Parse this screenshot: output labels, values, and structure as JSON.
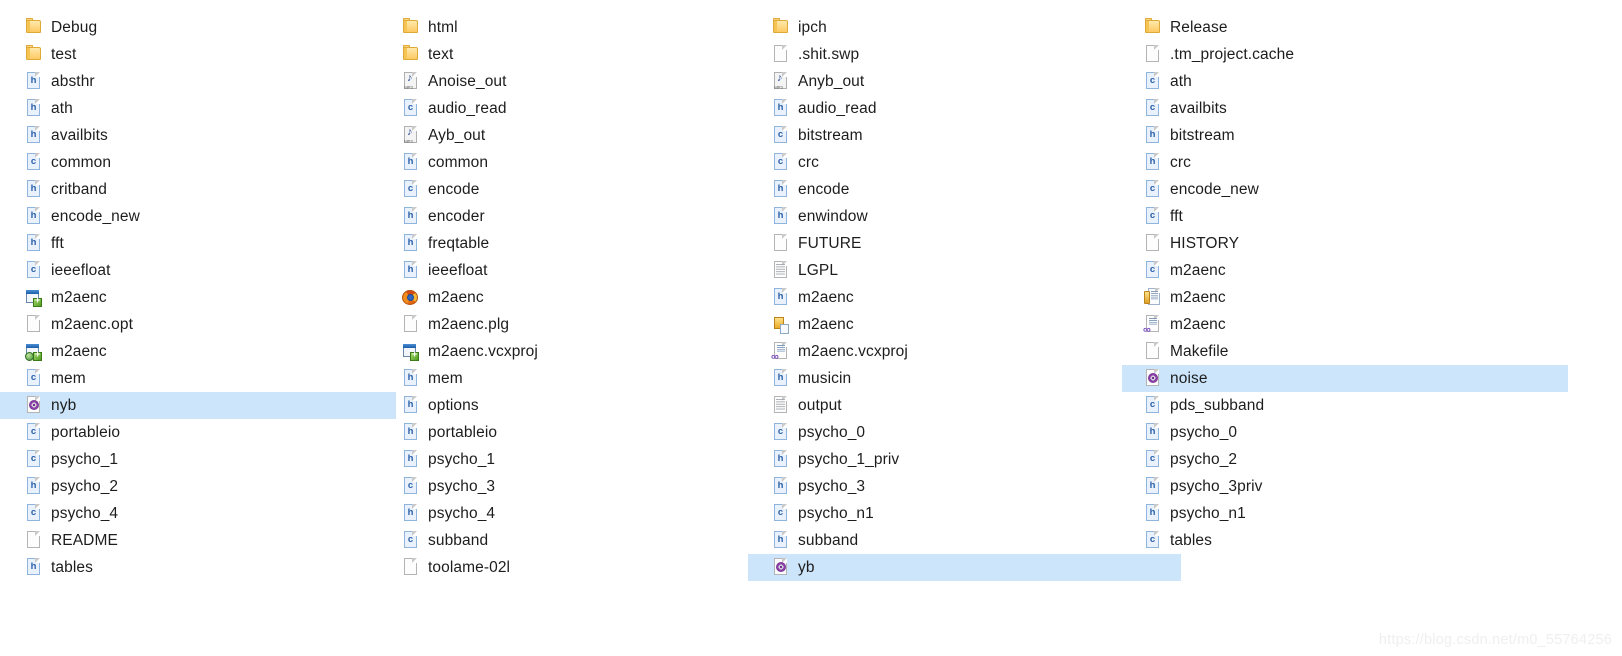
{
  "view": {
    "type": "file-explorer-listing",
    "selection_color": "#cce5fb",
    "background_color": "#ffffff",
    "watermark": "https://blog.csdn.net/m0_55764256"
  },
  "columns": [
    {
      "name": "column-1",
      "items": [
        {
          "label": "Debug",
          "icon": "folder-icon",
          "type": "folder",
          "selected": false
        },
        {
          "label": "test",
          "icon": "folder-icon",
          "type": "folder",
          "selected": false
        },
        {
          "label": "absthr",
          "icon": "h-header-file-icon",
          "type": "h",
          "selected": false
        },
        {
          "label": "ath",
          "icon": "h-header-file-icon",
          "type": "h",
          "selected": false
        },
        {
          "label": "availbits",
          "icon": "h-header-file-icon",
          "type": "h",
          "selected": false
        },
        {
          "label": "common",
          "icon": "c-source-file-icon",
          "type": "c",
          "selected": false
        },
        {
          "label": "critband",
          "icon": "h-header-file-icon",
          "type": "h",
          "selected": false
        },
        {
          "label": "encode_new",
          "icon": "h-header-file-icon",
          "type": "h",
          "selected": false
        },
        {
          "label": "fft",
          "icon": "h-header-file-icon",
          "type": "h",
          "selected": false
        },
        {
          "label": "ieeefloat",
          "icon": "c-source-file-icon",
          "type": "c",
          "selected": false
        },
        {
          "label": "m2aenc",
          "icon": "vs-project-icon",
          "type": "vsproj",
          "selected": false
        },
        {
          "label": "m2aenc.opt",
          "icon": "blank-document-icon",
          "type": "doc",
          "selected": false
        },
        {
          "label": "m2aenc",
          "icon": "vs-web-project-icon",
          "type": "vsweb",
          "selected": false
        },
        {
          "label": "mem",
          "icon": "c-source-file-icon",
          "type": "c",
          "selected": false
        },
        {
          "label": "nyb",
          "icon": "object-file-icon",
          "type": "obj",
          "selected": true
        },
        {
          "label": "portableio",
          "icon": "c-source-file-icon",
          "type": "c",
          "selected": false
        },
        {
          "label": "psycho_1",
          "icon": "c-source-file-icon",
          "type": "c",
          "selected": false
        },
        {
          "label": "psycho_2",
          "icon": "h-header-file-icon",
          "type": "h",
          "selected": false
        },
        {
          "label": "psycho_4",
          "icon": "c-source-file-icon",
          "type": "c",
          "selected": false
        },
        {
          "label": "README",
          "icon": "blank-document-icon",
          "type": "doc",
          "selected": false
        },
        {
          "label": "tables",
          "icon": "h-header-file-icon",
          "type": "h",
          "selected": false
        }
      ]
    },
    {
      "name": "column-2",
      "items": [
        {
          "label": "html",
          "icon": "folder-icon",
          "type": "folder",
          "selected": false
        },
        {
          "label": "text",
          "icon": "folder-icon",
          "type": "folder",
          "selected": false
        },
        {
          "label": "Anoise_out",
          "icon": "mp3-audio-icon",
          "type": "mp3",
          "selected": false
        },
        {
          "label": "audio_read",
          "icon": "c-source-file-icon",
          "type": "c",
          "selected": false
        },
        {
          "label": "Ayb_out",
          "icon": "mp3-audio-icon",
          "type": "mp3",
          "selected": false
        },
        {
          "label": "common",
          "icon": "h-header-file-icon",
          "type": "h",
          "selected": false
        },
        {
          "label": "encode",
          "icon": "c-source-file-icon",
          "type": "c",
          "selected": false
        },
        {
          "label": "encoder",
          "icon": "h-header-file-icon",
          "type": "h",
          "selected": false
        },
        {
          "label": "freqtable",
          "icon": "h-header-file-icon",
          "type": "h",
          "selected": false
        },
        {
          "label": "ieeefloat",
          "icon": "h-header-file-icon",
          "type": "h",
          "selected": false
        },
        {
          "label": "m2aenc",
          "icon": "firefox-app-icon",
          "type": "exe",
          "selected": false
        },
        {
          "label": "m2aenc.plg",
          "icon": "blank-document-icon",
          "type": "doc",
          "selected": false
        },
        {
          "label": "m2aenc.vcxproj",
          "icon": "vs-project-icon",
          "type": "vsproj",
          "selected": false
        },
        {
          "label": "mem",
          "icon": "h-header-file-icon",
          "type": "h",
          "selected": false
        },
        {
          "label": "options",
          "icon": "h-header-file-icon",
          "type": "h",
          "selected": false
        },
        {
          "label": "portableio",
          "icon": "h-header-file-icon",
          "type": "h",
          "selected": false
        },
        {
          "label": "psycho_1",
          "icon": "h-header-file-icon",
          "type": "h",
          "selected": false
        },
        {
          "label": "psycho_3",
          "icon": "c-source-file-icon",
          "type": "c",
          "selected": false
        },
        {
          "label": "psycho_4",
          "icon": "h-header-file-icon",
          "type": "h",
          "selected": false
        },
        {
          "label": "subband",
          "icon": "c-source-file-icon",
          "type": "c",
          "selected": false
        },
        {
          "label": "toolame-02l",
          "icon": "blank-document-icon",
          "type": "doc",
          "selected": false
        }
      ]
    },
    {
      "name": "column-3",
      "items": [
        {
          "label": "ipch",
          "icon": "folder-icon",
          "type": "folder",
          "selected": false
        },
        {
          "label": ".shit.swp",
          "icon": "blank-document-icon",
          "type": "doc",
          "selected": false
        },
        {
          "label": "Anyb_out",
          "icon": "mp3-audio-icon",
          "type": "mp3",
          "selected": false
        },
        {
          "label": "audio_read",
          "icon": "h-header-file-icon",
          "type": "h",
          "selected": false
        },
        {
          "label": "bitstream",
          "icon": "c-source-file-icon",
          "type": "c",
          "selected": false
        },
        {
          "label": "crc",
          "icon": "c-source-file-icon",
          "type": "c",
          "selected": false
        },
        {
          "label": "encode",
          "icon": "h-header-file-icon",
          "type": "h",
          "selected": false
        },
        {
          "label": "enwindow",
          "icon": "h-header-file-icon",
          "type": "h",
          "selected": false
        },
        {
          "label": "FUTURE",
          "icon": "blank-document-icon",
          "type": "doc",
          "selected": false
        },
        {
          "label": "LGPL",
          "icon": "text-document-icon",
          "type": "txt",
          "selected": false
        },
        {
          "label": "m2aenc",
          "icon": "h-header-file-icon",
          "type": "h",
          "selected": false
        },
        {
          "label": "m2aenc",
          "icon": "package-app-icon",
          "type": "exe",
          "selected": false
        },
        {
          "label": "m2aenc.vcxproj",
          "icon": "vcxproj-icon",
          "type": "vcxproj",
          "selected": false
        },
        {
          "label": "musicin",
          "icon": "h-header-file-icon",
          "type": "h",
          "selected": false
        },
        {
          "label": "output",
          "icon": "text-document-icon",
          "type": "txt",
          "selected": false
        },
        {
          "label": "psycho_0",
          "icon": "c-source-file-icon",
          "type": "c",
          "selected": false
        },
        {
          "label": "psycho_1_priv",
          "icon": "h-header-file-icon",
          "type": "h",
          "selected": false
        },
        {
          "label": "psycho_3",
          "icon": "h-header-file-icon",
          "type": "h",
          "selected": false
        },
        {
          "label": "psycho_n1",
          "icon": "c-source-file-icon",
          "type": "c",
          "selected": false
        },
        {
          "label": "subband",
          "icon": "h-header-file-icon",
          "type": "h",
          "selected": false
        },
        {
          "label": "yb",
          "icon": "object-file-icon",
          "type": "obj",
          "selected": true
        }
      ]
    },
    {
      "name": "column-4",
      "items": [
        {
          "label": "Release",
          "icon": "folder-icon",
          "type": "folder",
          "selected": false
        },
        {
          "label": ".tm_project.cache",
          "icon": "blank-document-icon",
          "type": "doc",
          "selected": false
        },
        {
          "label": "ath",
          "icon": "c-source-file-icon",
          "type": "c",
          "selected": false
        },
        {
          "label": "availbits",
          "icon": "c-source-file-icon",
          "type": "c",
          "selected": false
        },
        {
          "label": "bitstream",
          "icon": "h-header-file-icon",
          "type": "h",
          "selected": false
        },
        {
          "label": "crc",
          "icon": "h-header-file-icon",
          "type": "h",
          "selected": false
        },
        {
          "label": "encode_new",
          "icon": "c-source-file-icon",
          "type": "c",
          "selected": false
        },
        {
          "label": "fft",
          "icon": "c-source-file-icon",
          "type": "c",
          "selected": false
        },
        {
          "label": "HISTORY",
          "icon": "blank-document-icon",
          "type": "doc",
          "selected": false
        },
        {
          "label": "m2aenc",
          "icon": "c-source-file-icon",
          "type": "c",
          "selected": false
        },
        {
          "label": "m2aenc",
          "icon": "library-doc-icon",
          "type": "lib",
          "selected": false
        },
        {
          "label": "m2aenc",
          "icon": "vcxproj-icon",
          "type": "vcxproj",
          "selected": false
        },
        {
          "label": "Makefile",
          "icon": "blank-document-icon",
          "type": "doc",
          "selected": false
        },
        {
          "label": "noise",
          "icon": "object-file-icon",
          "type": "obj",
          "selected": true
        },
        {
          "label": "pds_subband",
          "icon": "c-source-file-icon",
          "type": "c",
          "selected": false
        },
        {
          "label": "psycho_0",
          "icon": "h-header-file-icon",
          "type": "h",
          "selected": false
        },
        {
          "label": "psycho_2",
          "icon": "c-source-file-icon",
          "type": "c",
          "selected": false
        },
        {
          "label": "psycho_3priv",
          "icon": "h-header-file-icon",
          "type": "h",
          "selected": false
        },
        {
          "label": "psycho_n1",
          "icon": "h-header-file-icon",
          "type": "h",
          "selected": false
        },
        {
          "label": "tables",
          "icon": "c-source-file-icon",
          "type": "c",
          "selected": false
        }
      ]
    }
  ]
}
